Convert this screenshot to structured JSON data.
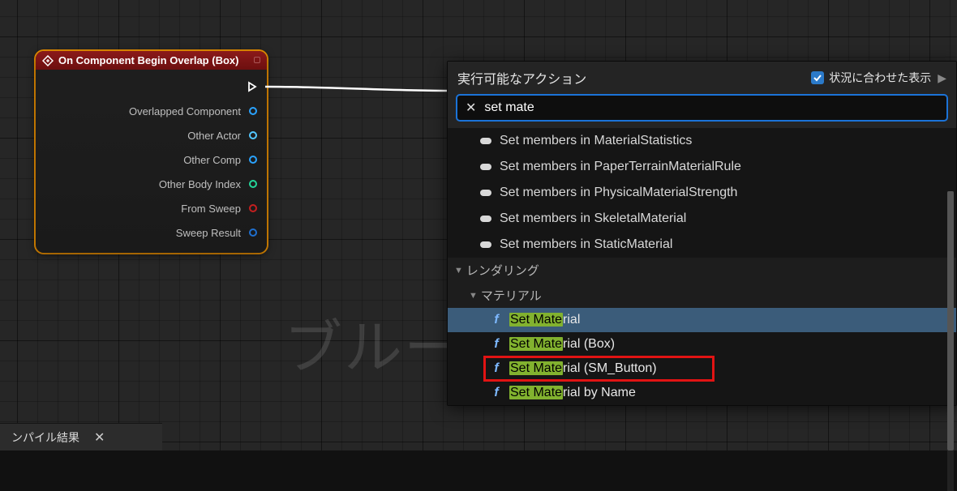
{
  "watermark": "ブルー",
  "node": {
    "title": "On Component Begin Overlap (Box)",
    "pins": [
      {
        "label": "",
        "kind": "exec"
      },
      {
        "label": "Overlapped Component",
        "kind": "obj"
      },
      {
        "label": "Other Actor",
        "kind": "actor"
      },
      {
        "label": "Other Comp",
        "kind": "obj"
      },
      {
        "label": "Other Body Index",
        "kind": "int"
      },
      {
        "label": "From Sweep",
        "kind": "bool"
      },
      {
        "label": "Sweep Result",
        "kind": "struct"
      }
    ]
  },
  "menu": {
    "title": "実行可能なアクション",
    "context_label": "状況に合わせた表示",
    "context_checked": true,
    "search_value": "set mate",
    "struct_results": [
      "Set members in MaterialStatistics",
      "Set members in PaperTerrainMaterialRule",
      "Set members in PhysicalMaterialStrength",
      "Set members in SkeletalMaterial",
      "Set members in StaticMaterial"
    ],
    "categories": {
      "rendering": "レンダリング",
      "material": "マテリアル"
    },
    "functions": [
      {
        "pre": "Set Mate",
        "post": "rial",
        "selected": true,
        "boxed": false
      },
      {
        "pre": "Set Mate",
        "post": "rial (Box)",
        "selected": false,
        "boxed": false
      },
      {
        "pre": "Set Mate",
        "post": "rial (SM_Button)",
        "selected": false,
        "boxed": true
      },
      {
        "pre": "Set Mate",
        "post": "rial by Name",
        "selected": false,
        "boxed": false
      }
    ]
  },
  "bottom_tab": {
    "label": "ンパイル結果"
  }
}
